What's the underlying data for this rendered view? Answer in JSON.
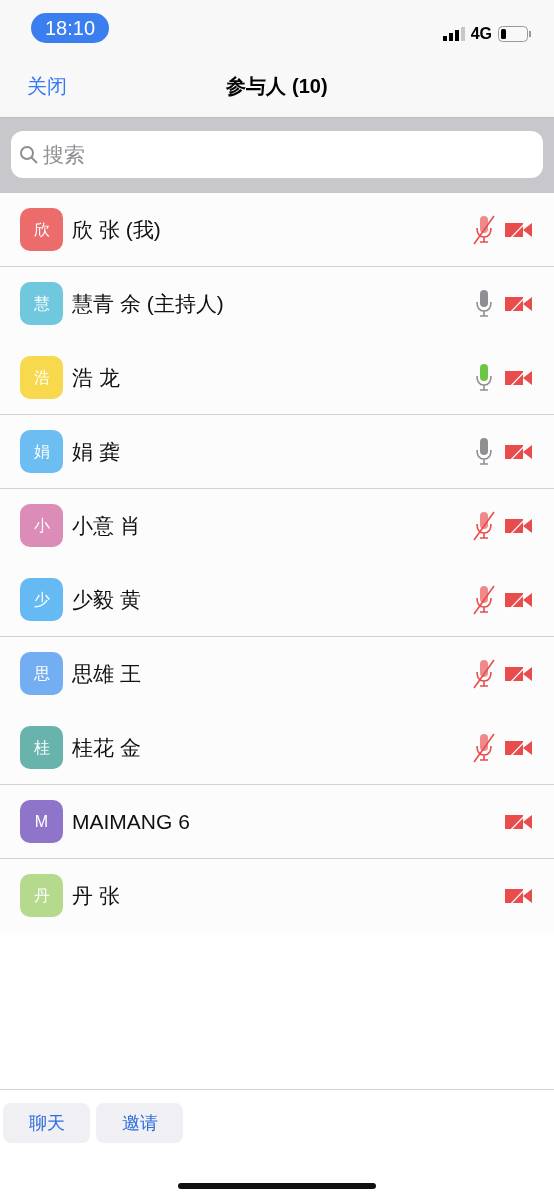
{
  "status_bar": {
    "time": "18:10",
    "network": "4G"
  },
  "nav": {
    "close": "关闭",
    "title": "参与人 (10)"
  },
  "search": {
    "placeholder": "搜索"
  },
  "participants": [
    {
      "initial": "欣",
      "name": "欣 张 (我)",
      "color": "#ec6b6b",
      "mic": {
        "kind": "muted"
      },
      "video_off": true,
      "divider": true
    },
    {
      "initial": "慧",
      "name": "慧青 余 (主持人)",
      "color": "#6fc8dd",
      "mic": {
        "kind": "idle"
      },
      "video_off": true,
      "divider": false
    },
    {
      "initial": "浩",
      "name": "浩 龙",
      "color": "#f8d94e",
      "mic": {
        "kind": "talking"
      },
      "video_off": true,
      "divider": true
    },
    {
      "initial": "娟",
      "name": "娟 龚",
      "color": "#6cbdf2",
      "mic": {
        "kind": "idle"
      },
      "video_off": true,
      "divider": true
    },
    {
      "initial": "小",
      "name": "小意 肖",
      "color": "#db8db7",
      "mic": {
        "kind": "muted"
      },
      "video_off": true,
      "divider": false
    },
    {
      "initial": "少",
      "name": "少毅 黄",
      "color": "#66baf3",
      "mic": {
        "kind": "muted"
      },
      "video_off": true,
      "divider": true
    },
    {
      "initial": "思",
      "name": "思雄 王",
      "color": "#73aef2",
      "mic": {
        "kind": "muted"
      },
      "video_off": true,
      "divider": false
    },
    {
      "initial": "桂",
      "name": "桂花 金",
      "color": "#68b3ab",
      "mic": {
        "kind": "muted"
      },
      "video_off": true,
      "divider": true
    },
    {
      "initial": "M",
      "name": "MAIMANG 6",
      "color": "#8f75c9",
      "video_off": true,
      "divider": true
    },
    {
      "initial": "丹",
      "name": "丹 张",
      "color": "#b5d98d",
      "video_off": true,
      "divider": false
    }
  ],
  "buttons": [
    "聊天",
    "邀请"
  ]
}
